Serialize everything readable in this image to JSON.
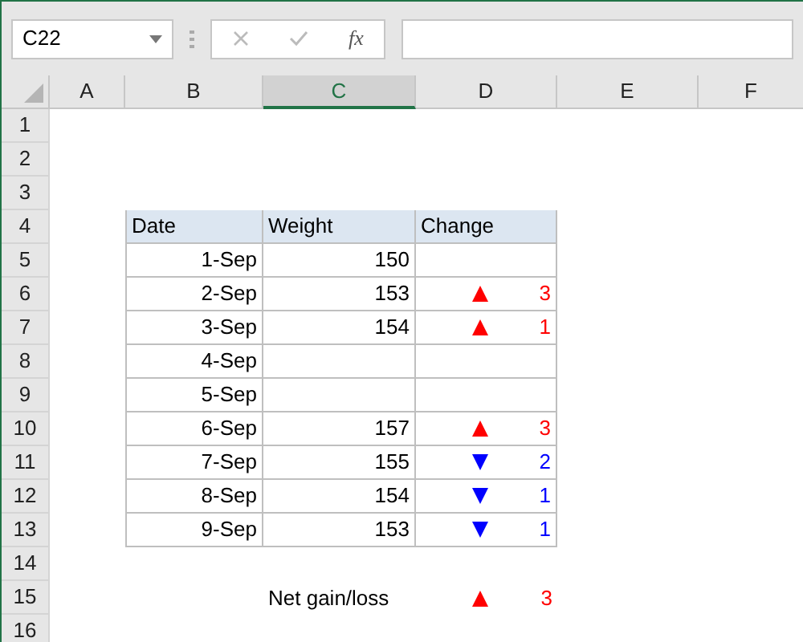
{
  "formula_bar": {
    "name_box": "C22",
    "function_label": "fx"
  },
  "columns": [
    {
      "label": "A",
      "selected": false
    },
    {
      "label": "B",
      "selected": false
    },
    {
      "label": "C",
      "selected": true
    },
    {
      "label": "D",
      "selected": false
    },
    {
      "label": "E",
      "selected": false
    },
    {
      "label": "F",
      "selected": false
    }
  ],
  "rows": [
    {
      "number": "1",
      "kind": "blank"
    },
    {
      "number": "2",
      "kind": "blank"
    },
    {
      "number": "3",
      "kind": "blank"
    },
    {
      "number": "4",
      "kind": "header",
      "date": "Date",
      "weight": "Weight",
      "change": {
        "kind": "text",
        "value": "Change"
      }
    },
    {
      "number": "5",
      "kind": "data",
      "date": "1-Sep",
      "weight": "150"
    },
    {
      "number": "6",
      "kind": "data",
      "date": "2-Sep",
      "weight": "153",
      "change": {
        "kind": "up",
        "value": "3"
      }
    },
    {
      "number": "7",
      "kind": "data",
      "date": "3-Sep",
      "weight": "154",
      "change": {
        "kind": "up",
        "value": "1"
      }
    },
    {
      "number": "8",
      "kind": "data",
      "date": "4-Sep"
    },
    {
      "number": "9",
      "kind": "data",
      "date": "5-Sep"
    },
    {
      "number": "10",
      "kind": "data",
      "date": "6-Sep",
      "weight": "157",
      "change": {
        "kind": "up",
        "value": "3"
      }
    },
    {
      "number": "11",
      "kind": "data",
      "date": "7-Sep",
      "weight": "155",
      "change": {
        "kind": "down",
        "value": "2"
      }
    },
    {
      "number": "12",
      "kind": "data",
      "date": "8-Sep",
      "weight": "154",
      "change": {
        "kind": "down",
        "value": "1"
      }
    },
    {
      "number": "13",
      "kind": "data",
      "date": "9-Sep",
      "weight": "153",
      "change": {
        "kind": "down",
        "value": "1"
      }
    },
    {
      "number": "14",
      "kind": "blank"
    },
    {
      "number": "15",
      "kind": "summary",
      "weight": "Net gain/loss",
      "change": {
        "kind": "up",
        "value": "3"
      }
    },
    {
      "number": "16",
      "kind": "blank"
    }
  ]
}
